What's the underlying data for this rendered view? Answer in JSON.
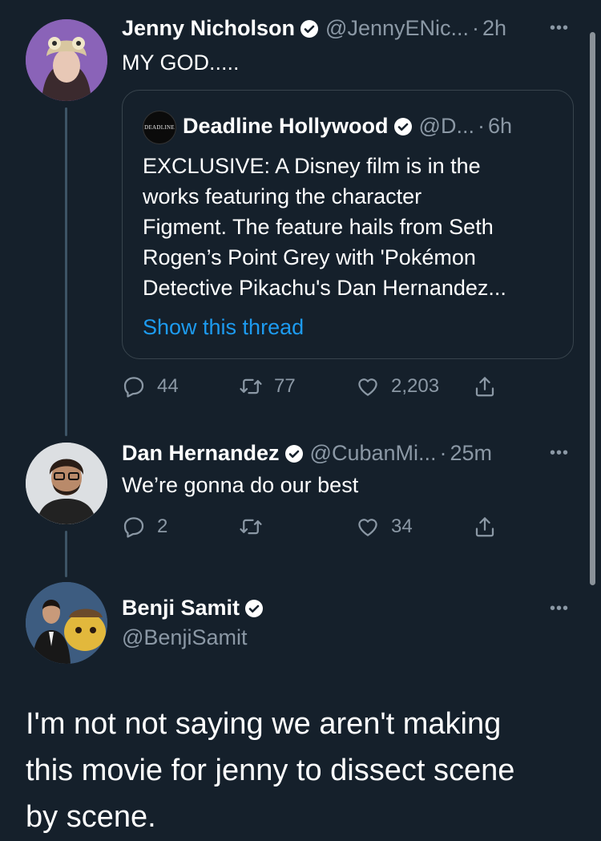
{
  "tweets": [
    {
      "name": "Jenny Nicholson",
      "handle": "@JennyENic...",
      "time": "2h",
      "text": "MY GOD.....",
      "quote": {
        "logo_text": "DEADLINE",
        "name": "Deadline Hollywood",
        "handle": "@D...",
        "time": "6h",
        "text_lines": [
          "EXCLUSIVE: A Disney film is in the",
          "works featuring the character",
          "Figment. The feature hails from Seth",
          "Rogen’s Point Grey with 'Pokémon",
          "Detective Pikachu's Dan Hernandez..."
        ],
        "show_thread": "Show this thread"
      },
      "replies": "44",
      "retweets": "77",
      "likes": "2,203"
    },
    {
      "name": "Dan Hernandez",
      "handle": "@CubanMi...",
      "time": "25m",
      "text": "We’re gonna do our best",
      "replies": "2",
      "retweets": "",
      "likes": "34"
    },
    {
      "name": "Benji Samit",
      "handle": "@BenjiSamit",
      "text_lines": [
        "I'm not not saying we aren't making",
        "this movie for jenny to dissect scene",
        "by scene."
      ]
    }
  ],
  "ui": {
    "more_icon": "more-horizontal-icon",
    "separator": "·"
  },
  "colors": {
    "background": "#15202b",
    "secondary_text": "#8b98a5",
    "link": "#1d9bf0",
    "border": "#38444d"
  }
}
